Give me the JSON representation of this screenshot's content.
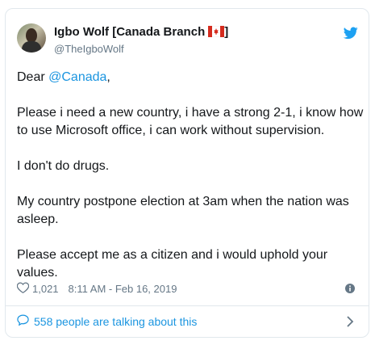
{
  "tweet": {
    "author_name": "Igbo Wolf [Canada Branch",
    "author_name_suffix": "]",
    "flag_icon": "canada-flag-emoji",
    "handle": "@TheIgboWolf",
    "brand_icon": "twitter-bird-icon",
    "greeting_prefix": "Dear ",
    "mention": "@Canada",
    "greeting_suffix": ",",
    "paragraph_1": "Please i need a new country, i have a strong 2-1, i know how to use Microsoft office, i can work without supervision.",
    "paragraph_2": "I don't do drugs.",
    "paragraph_3": "My country postpone election at 3am when the nation was asleep.",
    "paragraph_4": "Please accept me as a citizen and i would uphold your values.",
    "likes": "1,021",
    "timestamp": "8:11 AM - Feb 16, 2019",
    "conversation_text": "558 people are talking about this"
  },
  "colors": {
    "link": "#1b95e0",
    "secondary_text": "#657786",
    "border": "#e1e8ed",
    "primary_text": "#14171a"
  }
}
